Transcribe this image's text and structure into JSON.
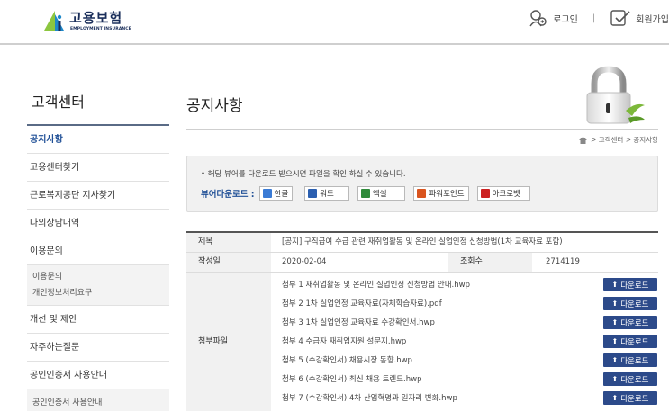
{
  "header": {
    "logo_title": "고용보험",
    "logo_subtitle": "EMPLOYMENT INSURANCE",
    "login_label": "로그인",
    "join_label": "회원가입"
  },
  "sidebar": {
    "title": "고객센터",
    "items": [
      {
        "label": "공지사항",
        "active": true
      },
      {
        "label": "고용센터찾기"
      },
      {
        "label": "근로복지공단 지사찾기"
      },
      {
        "label": "나의상담내역"
      },
      {
        "label": "이용문의"
      }
    ],
    "sub_items": [
      "이용문의",
      "개인정보처리요구"
    ],
    "items2": [
      {
        "label": "개선 및 제안"
      },
      {
        "label": "자주하는질문"
      },
      {
        "label": "공인인증서 사용안내"
      }
    ],
    "sub_items2": [
      "공인인증서 사용안내"
    ]
  },
  "main": {
    "title": "공지사항",
    "breadcrumb": [
      "고객센터",
      "공지사항"
    ],
    "viewer": {
      "notice": "• 해당 뷰어를 다운로드 받으시면 파일을 확인 하실 수 있습니다.",
      "label": "뷰어다운로드 :",
      "buttons": [
        {
          "label": "한글",
          "color": "#3a7bd5"
        },
        {
          "label": "워드",
          "color": "#2b5fb0"
        },
        {
          "label": "엑셀",
          "color": "#2f8a3a"
        },
        {
          "label": "파워포인트",
          "color": "#d9541e"
        },
        {
          "label": "아크로벳",
          "color": "#cc2020"
        }
      ]
    },
    "post": {
      "subject_label": "제목",
      "subject": "[공지] 구직급여 수급 관련 재취업활동 및 온라인 실업인정 신청방법(1차 교육자료 포함)",
      "date_label": "작성일",
      "date": "2020-02-04",
      "views_label": "조회수",
      "views": "2714119",
      "attach_label": "첨부파일",
      "download_label": "다운로드",
      "attachments": [
        "첨부 1 재취업활동 및 온라인 실업인정 신청방법 안내.hwp",
        "첨부 2 1차 실업인정 교육자료(자체학습자료).pdf",
        "첨부 3 1차 실업인정 교육자료 수강확인서.hwp",
        "첨부 4 수급자 재취업지원 설문지.hwp",
        "첨부 5 (수강확인서) 채용시장 동향.hwp",
        "첨부 6 (수강확인서) 최신 채용 트렌드.hwp",
        "첨부 7 (수강확인서) 4차 산업혁명과 일자리 변화.hwp"
      ]
    }
  }
}
